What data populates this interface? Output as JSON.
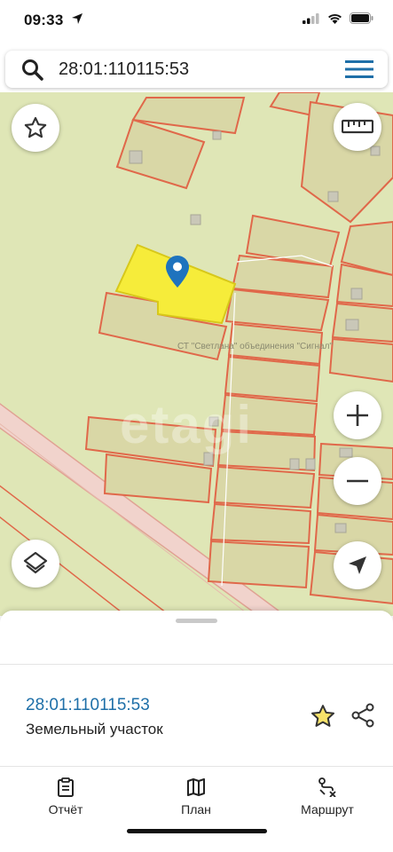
{
  "status": {
    "time": "09:33"
  },
  "search": {
    "query": "28:01:110115:53"
  },
  "map": {
    "label": "СТ \"Светлана\" объединения \"Сигнал\"",
    "watermark": "etagi",
    "colors": {
      "background": "#dfe6b6",
      "parcel_stroke": "#e0684a",
      "parcel_fill": "#d9d7a6",
      "selected_fill": "#f6ec3a",
      "marker": "#1e73be",
      "road": "#f1d3cc"
    },
    "buttons": [
      "star-icon",
      "ruler-icon",
      "zoom-in-icon",
      "zoom-out-icon",
      "layers-icon",
      "locate-icon"
    ]
  },
  "sheet": {
    "cadastral_number": "28:01:110115:53",
    "object_type": "Земельный участок"
  },
  "tabs": [
    {
      "label": "Отчёт",
      "icon": "report-icon"
    },
    {
      "label": "План",
      "icon": "map-icon"
    },
    {
      "label": "Маршрут",
      "icon": "route-icon"
    }
  ]
}
